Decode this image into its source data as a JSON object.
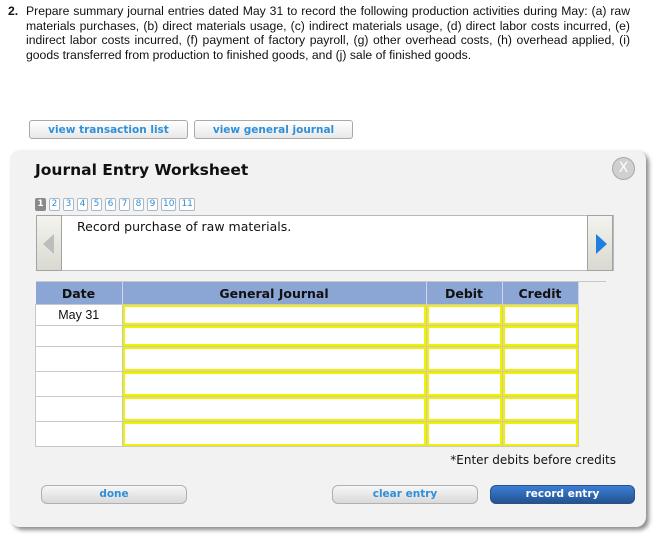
{
  "question": {
    "number": "2.",
    "text": "Prepare summary journal entries dated May 31 to record the following production activities during May: (a) raw materials purchases, (b) direct materials usage, (c) indirect materials usage, (d) direct labor costs incurred, (e) indirect labor costs incurred, (f) payment of factory payroll, (g) other overhead costs, (h) overhead applied, (i) goods transferred from production to finished goods, and (j) sale of finished goods."
  },
  "top_buttons": {
    "view_transaction_list": "view transaction list",
    "view_general_journal": "view general journal"
  },
  "worksheet": {
    "title": "Journal Entry Worksheet",
    "close_icon": "X",
    "tabs": [
      "1",
      "2",
      "3",
      "4",
      "5",
      "6",
      "7",
      "8",
      "9",
      "10",
      "11"
    ],
    "active_tab": "1",
    "description": "Record purchase of raw materials.",
    "table": {
      "headers": {
        "date": "Date",
        "general_journal": "General Journal",
        "debit": "Debit",
        "credit": "Credit"
      },
      "rows": [
        {
          "date": "May 31",
          "account": "",
          "debit": "",
          "credit": ""
        },
        {
          "date": "",
          "account": "",
          "debit": "",
          "credit": ""
        },
        {
          "date": "",
          "account": "",
          "debit": "",
          "credit": ""
        },
        {
          "date": "",
          "account": "",
          "debit": "",
          "credit": ""
        },
        {
          "date": "",
          "account": "",
          "debit": "",
          "credit": ""
        },
        {
          "date": "",
          "account": "",
          "debit": "",
          "credit": ""
        }
      ]
    },
    "note": "*Enter debits before credits",
    "buttons": {
      "done": "done",
      "clear_entry": "clear entry",
      "record_entry": "record entry"
    }
  },
  "icons": {
    "prev": "chevron-left-icon",
    "next": "chevron-right-icon",
    "close": "close-icon"
  }
}
